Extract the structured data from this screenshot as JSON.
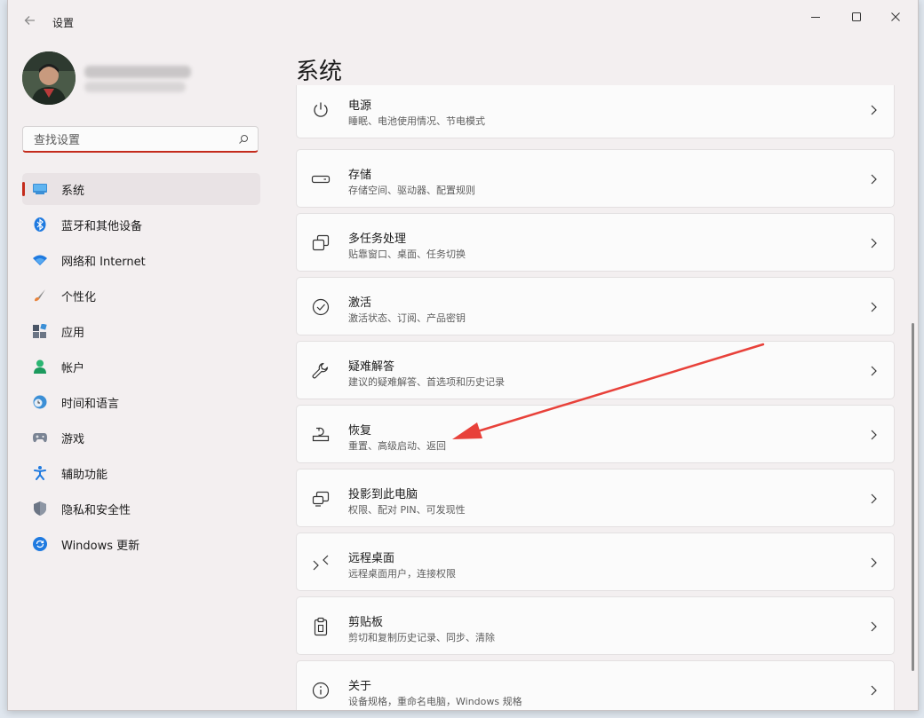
{
  "window": {
    "title": "设置"
  },
  "search": {
    "placeholder": "查找设置"
  },
  "page_title": "系统",
  "nav": [
    {
      "label": "系统",
      "icon": "system-icon",
      "active": true
    },
    {
      "label": "蓝牙和其他设备",
      "icon": "bluetooth-icon"
    },
    {
      "label": "网络和 Internet",
      "icon": "wifi-icon"
    },
    {
      "label": "个性化",
      "icon": "brush-icon"
    },
    {
      "label": "应用",
      "icon": "apps-icon"
    },
    {
      "label": "帐户",
      "icon": "person-icon"
    },
    {
      "label": "时间和语言",
      "icon": "clock-globe-icon"
    },
    {
      "label": "游戏",
      "icon": "gamepad-icon"
    },
    {
      "label": "辅助功能",
      "icon": "accessibility-icon"
    },
    {
      "label": "隐私和安全性",
      "icon": "shield-icon"
    },
    {
      "label": "Windows 更新",
      "icon": "update-icon"
    }
  ],
  "cards": [
    {
      "title": "电源",
      "subtitle": "睡眠、电池使用情况、节电模式",
      "icon": "power-icon"
    },
    {
      "title": "存储",
      "subtitle": "存储空间、驱动器、配置规则",
      "icon": "storage-icon"
    },
    {
      "title": "多任务处理",
      "subtitle": "贴靠窗口、桌面、任务切换",
      "icon": "multitask-icon"
    },
    {
      "title": "激活",
      "subtitle": "激活状态、订阅、产品密钥",
      "icon": "check-circle-icon"
    },
    {
      "title": "疑难解答",
      "subtitle": "建议的疑难解答、首选项和历史记录",
      "icon": "wrench-icon"
    },
    {
      "title": "恢复",
      "subtitle": "重置、高级启动、返回",
      "icon": "recovery-icon"
    },
    {
      "title": "投影到此电脑",
      "subtitle": "权限、配对 PIN、可发现性",
      "icon": "project-icon"
    },
    {
      "title": "远程桌面",
      "subtitle": "远程桌面用户，连接权限",
      "icon": "remote-desktop-icon"
    },
    {
      "title": "剪贴板",
      "subtitle": "剪切和复制历史记录、同步、清除",
      "icon": "clipboard-icon"
    },
    {
      "title": "关于",
      "subtitle": "设备规格，重命名电脑，Windows 规格",
      "icon": "info-icon"
    }
  ],
  "colors": {
    "accent": "#c42b1c",
    "annotation_arrow": "#e8413a"
  }
}
